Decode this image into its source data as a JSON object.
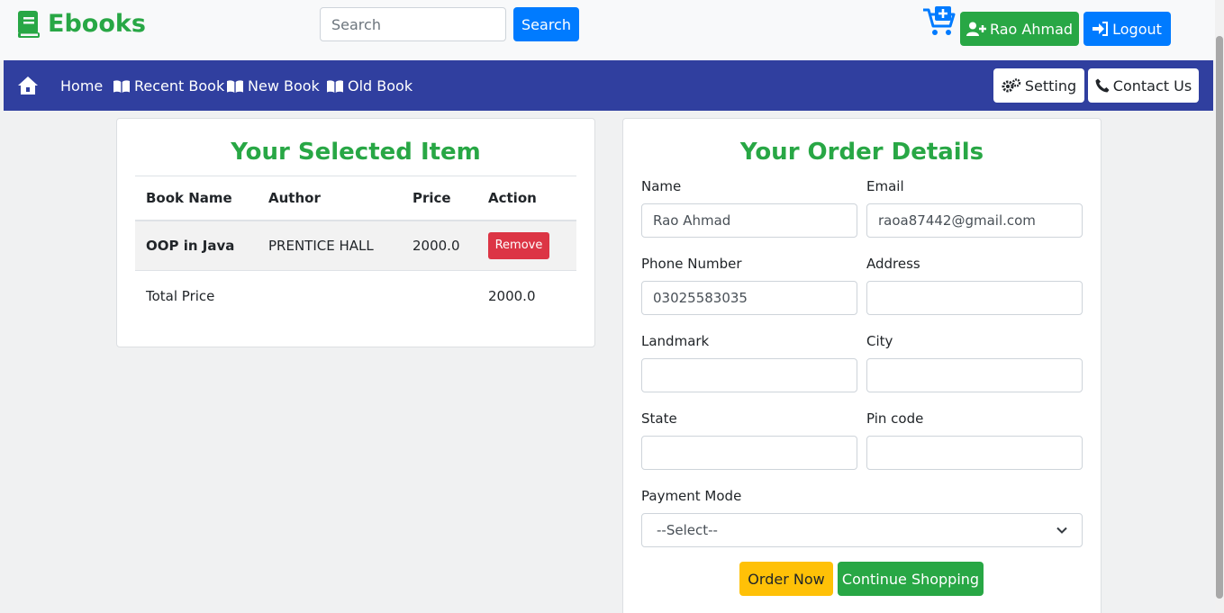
{
  "header": {
    "brand": "Ebooks",
    "search_placeholder": "Search",
    "search_button": "Search",
    "user_button": "Rao Ahmad",
    "logout_button": "Logout"
  },
  "nav": {
    "items": [
      "Home",
      "Recent Book",
      "New Book",
      "Old Book"
    ],
    "setting": "Setting",
    "contact": "Contact Us"
  },
  "cart": {
    "title": "Your Selected Item",
    "columns": [
      "Book Name",
      "Author",
      "Price",
      "Action"
    ],
    "rows": [
      {
        "book": "OOP in Java",
        "author": "PRENTICE HALL",
        "price": "2000.0",
        "action": "Remove"
      }
    ],
    "total_label": "Total Price",
    "total_value": "2000.0"
  },
  "order": {
    "title": "Your Order Details",
    "name_label": "Name",
    "name_value": "Rao Ahmad",
    "email_label": "Email",
    "email_value": "raoa87442@gmail.com",
    "phone_label": "Phone Number",
    "phone_value": "03025583035",
    "address_label": "Address",
    "address_value": "",
    "landmark_label": "Landmark",
    "landmark_value": "",
    "city_label": "City",
    "city_value": "",
    "state_label": "State",
    "state_value": "",
    "pin_label": "Pin code",
    "pin_value": "",
    "payment_label": "Payment Mode",
    "payment_selected": "--Select--",
    "order_button": "Order Now",
    "continue_button": "Continue Shopping"
  },
  "colors": {
    "brand_green": "#28a745",
    "primary_blue": "#007bff",
    "nav_blue": "#303f9f",
    "danger_red": "#dc3545",
    "warning_yellow": "#ffc107"
  }
}
